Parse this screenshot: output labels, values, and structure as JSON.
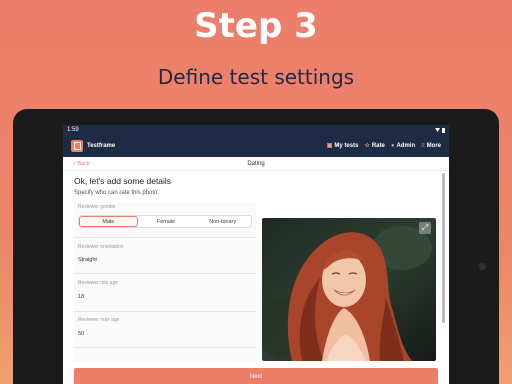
{
  "hero": {
    "title": "Step 3",
    "subtitle": "Define test settings"
  },
  "statusbar": {
    "time": "1:59"
  },
  "app": {
    "name": "Testframe",
    "nav": [
      {
        "label": "My tests",
        "icon": "gallery-icon"
      },
      {
        "label": "Rate",
        "icon": "star-icon"
      },
      {
        "label": "Admin",
        "icon": "users-icon"
      },
      {
        "label": "More",
        "icon": "menu-icon"
      }
    ]
  },
  "subheader": {
    "back_label": "Back",
    "title": "Dating"
  },
  "form": {
    "heading": "Ok, let's add some details",
    "subheading": "Specify who can rate this photo.",
    "gender": {
      "label": "Reviewer gender",
      "options": [
        "Male",
        "Female",
        "Non-binary"
      ],
      "selected": "Male"
    },
    "orientation": {
      "label": "Reviewer orientation",
      "value": "Straight"
    },
    "min_age": {
      "label": "Reviewer min age",
      "value": "18"
    },
    "max_age": {
      "label": "Reviewer max age",
      "value": "50"
    },
    "next_label": "Next"
  },
  "colors": {
    "accent": "#ee7e68",
    "nav_bg": "#1f2a44",
    "background": "#ec7e6b"
  }
}
